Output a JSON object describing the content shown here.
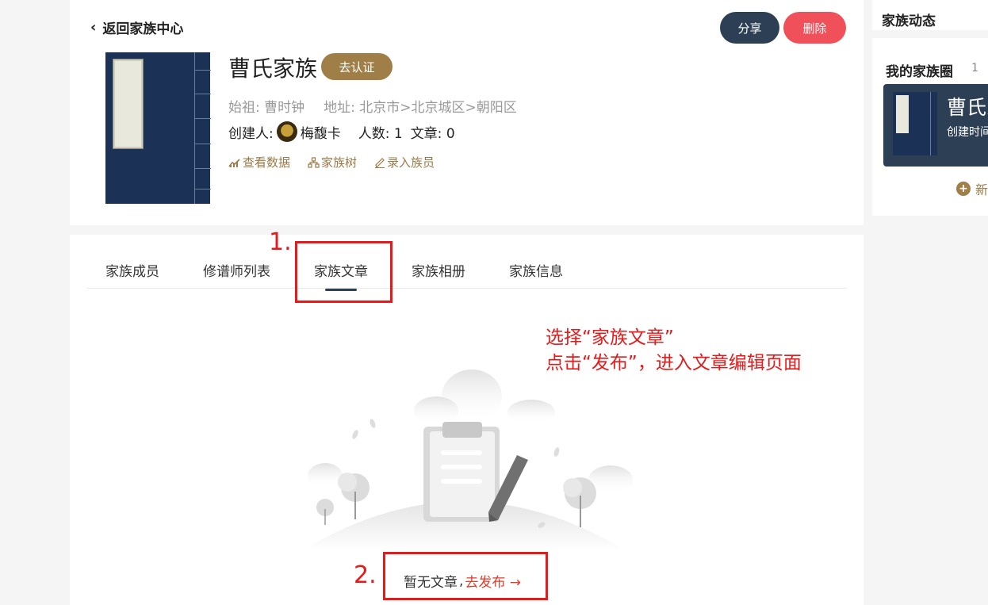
{
  "header": {
    "back_label": "返回家族中心",
    "share_label": "分享",
    "delete_label": "删除"
  },
  "family": {
    "name": "曹氏家族",
    "verify_label": "去认证",
    "ancestor": "始祖: 曹时钟",
    "address": "地址: 北京市>北京城区>朝阳区",
    "creator_prefix": "创建人:",
    "creator_name": "梅馥卡",
    "member_count": "人数: 1",
    "article_count": "文章: 0",
    "actions": {
      "view_data": "查看数据",
      "family_tree": "家族树",
      "add_member": "录入族员"
    }
  },
  "tabs": [
    "家族成员",
    "修谱师列表",
    "家族文章",
    "家族相册",
    "家族信息"
  ],
  "annotations": {
    "step1": "1.",
    "step2": "2.",
    "instruction_line1": "选择“家族文章”",
    "instruction_line2": "点击“发布”，进入文章编辑页面"
  },
  "empty_state": {
    "text": "暂无文章",
    "separator": ",",
    "publish_label": "去发布 →"
  },
  "sidebar": {
    "feed_title": "家族动态",
    "circle_title": "我的家族圈",
    "circle_count": "1",
    "circle_item_name": "曹氏家",
    "circle_item_created": "创建时间",
    "new_label": "新"
  },
  "colors": {
    "accent_gold": "#a07e47",
    "dark_navy": "#2c3f55",
    "delete_red": "#f0505a",
    "annotation_red": "#e51a1a"
  }
}
